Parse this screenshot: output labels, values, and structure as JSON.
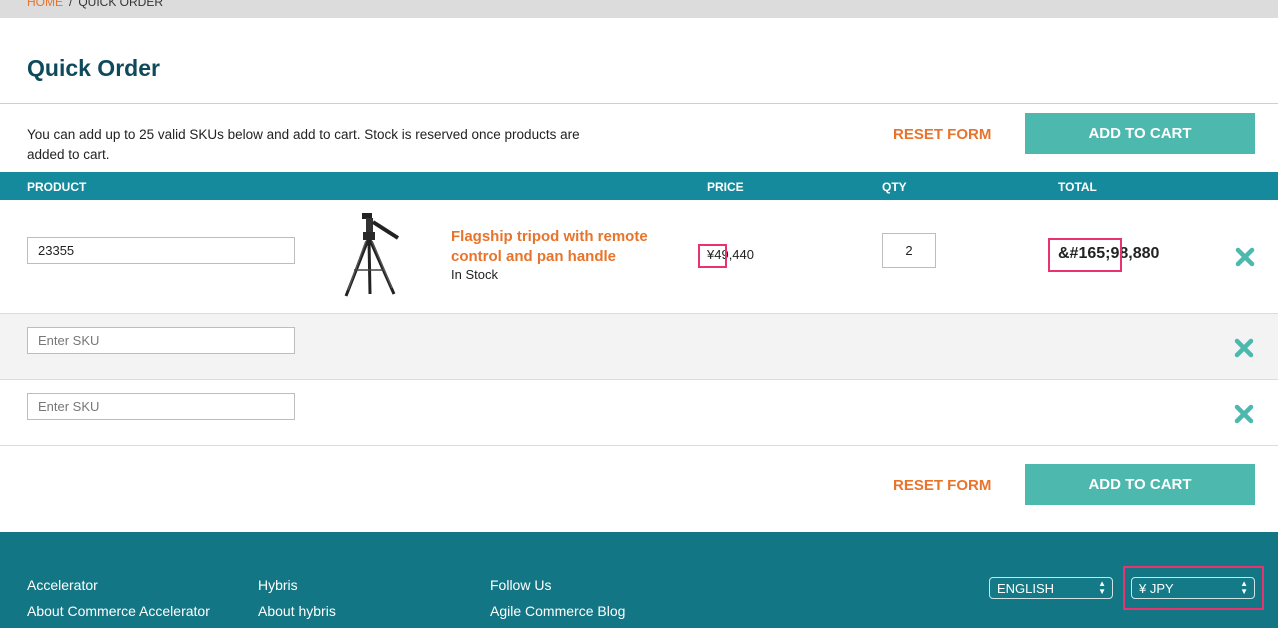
{
  "breadcrumb": {
    "home": "HOME",
    "separator": "/",
    "current": "QUICK ORDER"
  },
  "page": {
    "title": "Quick Order",
    "intro": "You can add up to 25 valid SKUs below and add to cart. Stock is reserved once products are added to cart."
  },
  "actions": {
    "reset_label": "RESET FORM",
    "add_to_cart_label": "ADD TO CART"
  },
  "table": {
    "headers": {
      "product": "PRODUCT",
      "price": "PRICE",
      "qty": "QTY",
      "total": "TOTAL"
    },
    "rows": [
      {
        "sku": "23355",
        "product_name": "Flagship tripod with remote control and pan handle",
        "stock": "In Stock",
        "price": "¥49,440",
        "qty": "2",
        "total": "&#165;98,880"
      },
      {
        "sku_placeholder": "Enter SKU"
      },
      {
        "sku_placeholder": "Enter SKU"
      }
    ]
  },
  "footer": {
    "col1": [
      "Accelerator",
      "About Commerce Accelerator"
    ],
    "col2": [
      "Hybris",
      "About hybris"
    ],
    "col3": [
      "Follow Us",
      "Agile Commerce Blog"
    ],
    "language": "ENGLISH",
    "currency": "¥ JPY"
  },
  "colors": {
    "accent_orange": "#e8742c",
    "teal_button": "#4db8ae",
    "table_header": "#158a9c",
    "footer_bg": "#137685",
    "highlight": "#e8336f"
  },
  "icons": {
    "remove": "close-x-icon",
    "select_arrows": "updown-arrows-icon"
  }
}
